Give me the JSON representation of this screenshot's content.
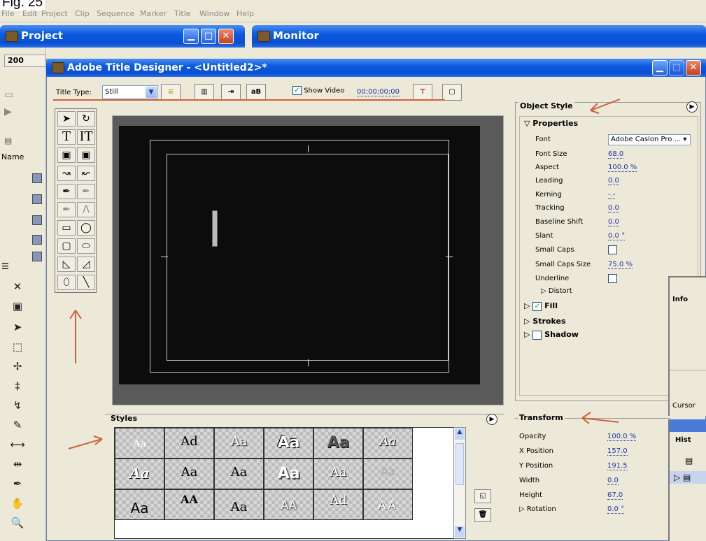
{
  "figure_label": "Fig. 25",
  "menu": [
    "File",
    "Edit",
    "Project",
    "Clip",
    "Sequence",
    "Marker",
    "Title",
    "Window",
    "Help"
  ],
  "project_window": {
    "title": "Project",
    "tab_label": "200",
    "name_label": "Name"
  },
  "monitor_window": {
    "title": "Monitor"
  },
  "designer": {
    "title": "Adobe Title Designer - <Untitled2>*",
    "title_type_label": "Title Type:",
    "title_type_value": "Still",
    "show_video_label": "Show Video",
    "show_video_checked": true,
    "timecode": "00;00;00;00"
  },
  "object_style": {
    "heading": "Object Style",
    "properties_label": "Properties",
    "rows": [
      {
        "label": "Font",
        "value": "Adobe Caslon Pro ..."
      },
      {
        "label": "Font Size",
        "value": "68.0"
      },
      {
        "label": "Aspect",
        "value": "100.0 %"
      },
      {
        "label": "Leading",
        "value": "0.0"
      },
      {
        "label": "Kerning",
        "value": "-.-"
      },
      {
        "label": "Tracking",
        "value": "0.0"
      },
      {
        "label": "Baseline Shift",
        "value": "0.0"
      },
      {
        "label": "Slant",
        "value": "0.0 °"
      },
      {
        "label": "Small Caps",
        "value": ""
      },
      {
        "label": "Small Caps Size",
        "value": "75.0 %"
      },
      {
        "label": "Underline",
        "value": ""
      },
      {
        "label": "Distort",
        "value": ""
      }
    ],
    "fill_label": "Fill",
    "strokes_label": "Strokes",
    "shadow_label": "Shadow"
  },
  "styles": {
    "heading": "Styles",
    "cells": [
      "Aa",
      "Ad",
      "Aa",
      "Aa",
      "Aa",
      "Aa",
      "Aa",
      "Aa",
      "Aa",
      "Aa",
      "Aa",
      "Aa",
      "Aa",
      "AA",
      "Aa",
      "AA",
      "Ad",
      "AA"
    ]
  },
  "transform": {
    "heading": "Transform",
    "rows": [
      {
        "label": "Opacity",
        "value": "100.0 %"
      },
      {
        "label": "X Position",
        "value": "157.0"
      },
      {
        "label": "Y Position",
        "value": "191.5"
      },
      {
        "label": "Width",
        "value": "0.0"
      },
      {
        "label": "Height",
        "value": "67.0"
      },
      {
        "label": "Rotation",
        "value": "0.0 °"
      }
    ]
  },
  "info_panel": {
    "title": "Info",
    "cursor_label": "Cursor"
  },
  "history_panel": {
    "title": "Hist"
  },
  "colors": {
    "annotation_arrow": "#d0603a",
    "xp_title_blue": "#0a5ae0",
    "canvas": "#0c0c0c"
  }
}
